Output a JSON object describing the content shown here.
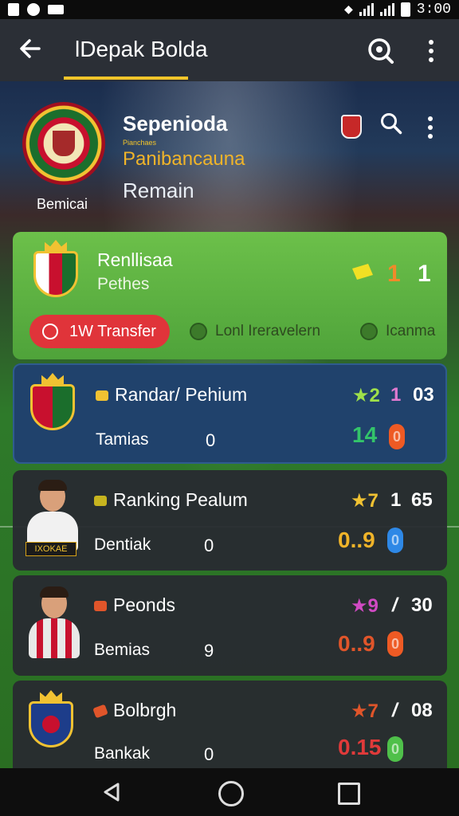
{
  "status_bar": {
    "time": "3:00"
  },
  "app_bar": {
    "title": "lDepak Bolda"
  },
  "header": {
    "title": "Sepenioda",
    "sub_small": "Pianchaes",
    "subtitle": "Panibancauna",
    "remain": "Remain",
    "badge_caption": "Bemicai"
  },
  "featured": {
    "name": "Renllisaa",
    "sub": "Pethes",
    "score_a": "1",
    "score_b": "1",
    "transfer_label": "1W Transfer",
    "chip_one": "Lonl Ireravelern",
    "chip_two": "Icanma"
  },
  "rows": [
    {
      "title": "Randar/ Pehium",
      "label": "Tamias",
      "value": "0",
      "stat_a": "★2",
      "stat_b": "1",
      "stat_c": "03",
      "figure": "14",
      "pill": "0"
    },
    {
      "title": "Ranking Pealum",
      "label": "Dentiak",
      "value": "0",
      "stat_a": "★7",
      "stat_b": "1",
      "stat_c": "65",
      "figure": "0..9",
      "pill": "0",
      "plate": "IXOKAE"
    },
    {
      "title": "Peonds",
      "label": "Bemias",
      "value": "9",
      "stat_a": "★9",
      "stat_b": "/",
      "stat_c": "30",
      "figure": "0..9",
      "pill": "0"
    },
    {
      "title": "Bolbrgh",
      "label": "Bankak",
      "value": "0",
      "stat_a": "★7",
      "stat_b": "/",
      "stat_c": "08",
      "figure": "0.15",
      "pill": "0"
    }
  ],
  "colors": {
    "accent": "#f3c52a",
    "featured_card": "#5cb044",
    "selected_card": "#20426c",
    "transfer_button": "#e0343a"
  }
}
